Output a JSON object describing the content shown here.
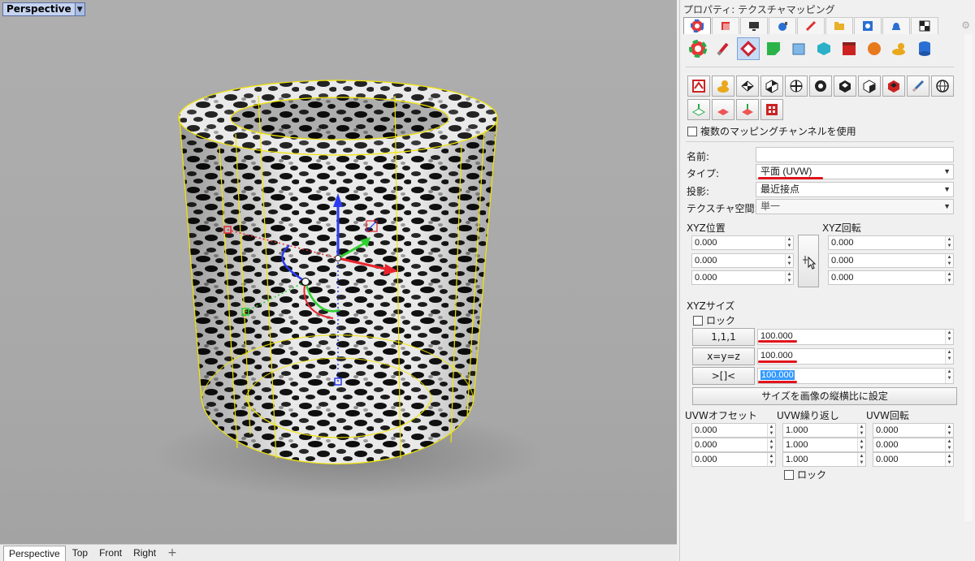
{
  "viewport": {
    "title": "Perspective",
    "tabs": [
      "Perspective",
      "Top",
      "Front",
      "Right"
    ],
    "active_tab": "Perspective",
    "add_tab_glyph": "+"
  },
  "panel": {
    "title": "プロパティ: テクスチャマッピング",
    "multi_channel_label": "複数のマッピングチャンネルを使用",
    "name_label": "名前:",
    "name_value": "",
    "type_label": "タイプ:",
    "type_value": "平面 (UVW)",
    "projection_label": "投影:",
    "projection_value": "最近接点",
    "space_label": "テクスチャ空間:",
    "space_value": "単一",
    "xyz_position_label": "XYZ位置",
    "xyz_rotation_label": "XYZ回転",
    "xyz_position": [
      "0.000",
      "0.000",
      "0.000"
    ],
    "xyz_rotation": [
      "0.000",
      "0.000",
      "0.000"
    ],
    "xyz_size_label": "XYZサイズ",
    "lock_label": "ロック",
    "size_buttons": [
      "1,1,1",
      "x=y=z",
      ">[]<"
    ],
    "size_values": [
      "100.000",
      "100.000",
      "100.000"
    ],
    "fit_image_button": "サイズを画像の縦横比に設定",
    "uvw_offset_label": "UVWオフセット",
    "uvw_repeat_label": "UVW繰り返し",
    "uvw_rotation_label": "UVW回転",
    "uvw_offset": [
      "0.000",
      "0.000",
      "0.000"
    ],
    "uvw_repeat": [
      "1.000",
      "1.000",
      "1.000"
    ],
    "uvw_rotation": [
      "0.000",
      "0.000",
      "0.000"
    ],
    "uvw_lock_label": "ロック"
  },
  "colors": {
    "accent_red": "#e0141c",
    "selection_yellow": "#f2e600",
    "gizmo_x": "#e8242c",
    "gizmo_y": "#2fd12f",
    "gizmo_z": "#2b3cf0"
  }
}
